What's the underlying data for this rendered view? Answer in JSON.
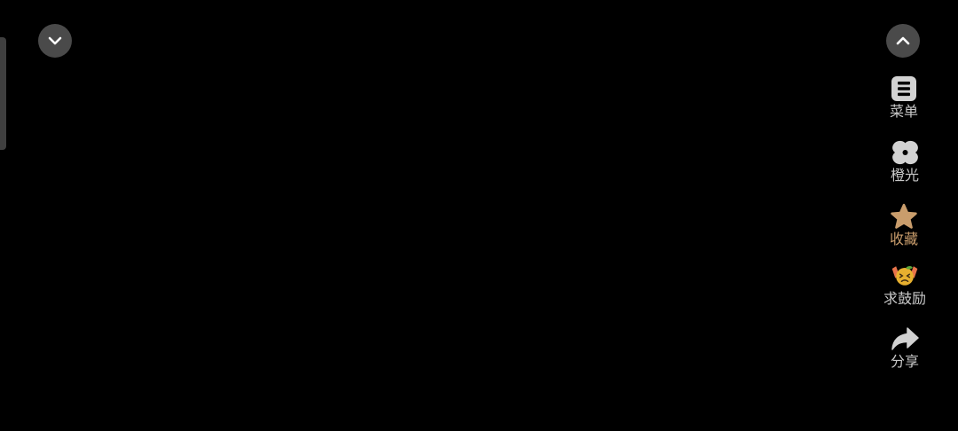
{
  "side_actions": {
    "menu": {
      "label": "菜单",
      "icon": "menu-icon"
    },
    "light": {
      "label": "橙光",
      "icon": "orange-light-logo-icon"
    },
    "favorite": {
      "label": "收藏",
      "icon": "star-icon"
    },
    "encourage": {
      "label": "求鼓励",
      "icon": "encourage-emoji-icon"
    },
    "share": {
      "label": "分享",
      "icon": "share-arrow-icon"
    }
  },
  "colors": {
    "background": "#000000",
    "button_bg": "#4a4a4a",
    "label": "#c9c9c9",
    "favorite_accent": "#c99d6c",
    "icon_gray": "#d2d2d2"
  }
}
